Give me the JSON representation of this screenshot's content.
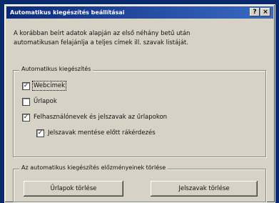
{
  "dialog": {
    "title": "Automatikus kiegészítés beállításai",
    "help_glyph": "?",
    "close_glyph": "×",
    "description_line1": "A korábban beírt adatok alapján az első néhány betű után",
    "description_line2": "automatikusan felajánlja a teljes címek ill. szavak listáját."
  },
  "autocomplete_group": {
    "legend": "Automatikus kiegészítés",
    "options": [
      {
        "label": "Webcímek",
        "checked": true,
        "mark": "✓"
      },
      {
        "label": "Űrlapok",
        "checked": false,
        "mark": ""
      },
      {
        "label": "Felhasználónevek és jelszavak az űrlapokon",
        "checked": true,
        "mark": "✓"
      },
      {
        "label": "Jelszavak mentése előtt rákérdezés",
        "checked": true,
        "mark": "✓"
      }
    ]
  },
  "clear_group": {
    "legend": "Az automatikus kiegészítés előzményeinek törlése",
    "clear_forms_label": "Űrlapok törlése",
    "clear_passwords_label": "Jelszavak törlése"
  }
}
